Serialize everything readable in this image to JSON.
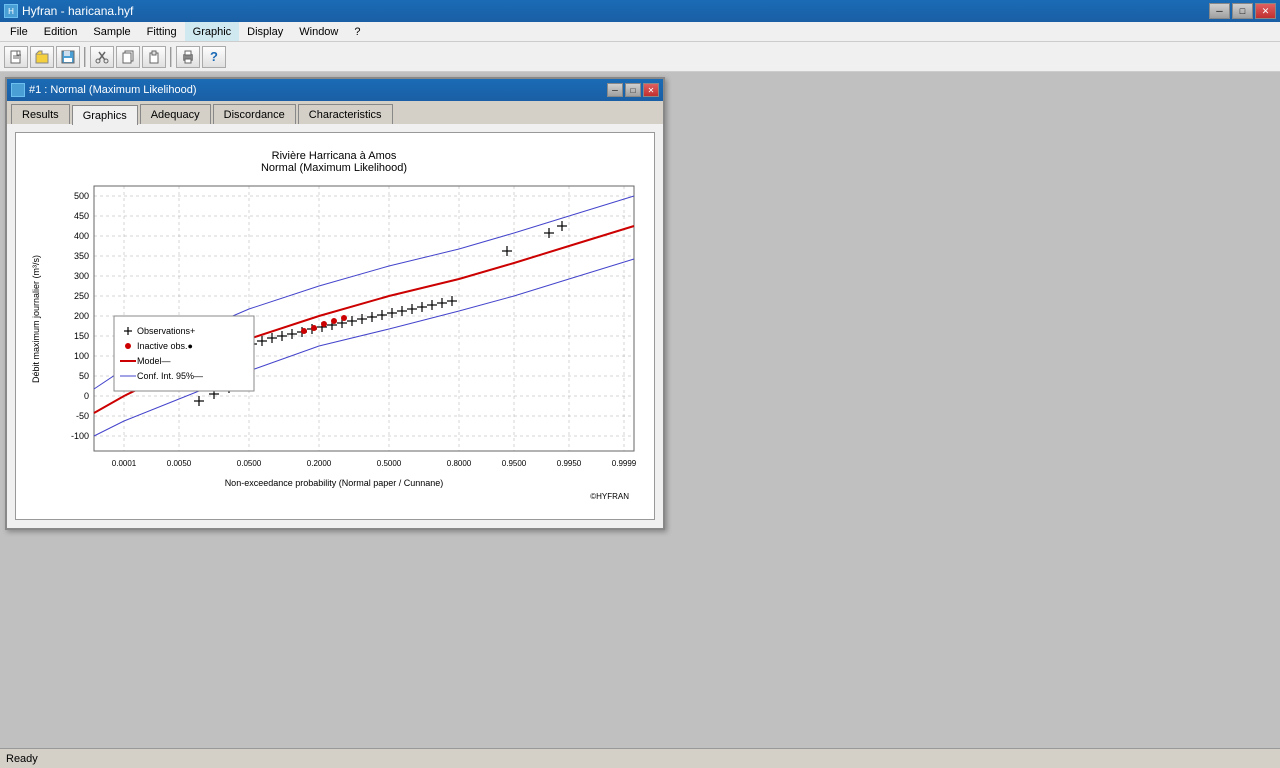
{
  "app": {
    "title": "Hyfran - haricana.hyf",
    "icon": "📊"
  },
  "menu": {
    "items": [
      "File",
      "Edition",
      "Sample",
      "Fitting",
      "Graphic",
      "Display",
      "Window",
      "?"
    ]
  },
  "toolbar": {
    "buttons": [
      {
        "name": "new",
        "icon": "🗋"
      },
      {
        "name": "open",
        "icon": "📂"
      },
      {
        "name": "save",
        "icon": "💾"
      },
      {
        "name": "cut",
        "icon": "✂"
      },
      {
        "name": "copy",
        "icon": "📋"
      },
      {
        "name": "paste",
        "icon": "📌"
      },
      {
        "name": "print",
        "icon": "🖨"
      },
      {
        "name": "help",
        "icon": "?"
      }
    ]
  },
  "panel": {
    "title": "#1 : Normal (Maximum Likelihood)",
    "tabs": [
      "Results",
      "Graphics",
      "Adequacy",
      "Discordance",
      "Characteristics"
    ],
    "active_tab": "Graphics"
  },
  "chart": {
    "title_line1": "Rivière Harricana à Amos",
    "title_line2": "Normal (Maximum Likelihood)",
    "x_label": "Non-exceedance probability (Normal paper / Cunnane)",
    "y_label": "Débit maximum journalier (m³/s)",
    "copyright": "©HYFRAN",
    "legend": {
      "observations": "Observations+",
      "inactive": "Inactive obs.●",
      "model": "Model—",
      "conf_int": "Conf. Int. 95%—"
    },
    "y_axis": [
      "-100",
      "-50",
      "0",
      "50",
      "100",
      "150",
      "200",
      "250",
      "300",
      "350",
      "400",
      "450",
      "500"
    ],
    "x_axis": [
      "0.0001",
      "0.0050",
      "0.0500",
      "0.2000",
      "0.5000",
      "0.8000",
      "0.9500",
      "0.9950",
      "0.9999"
    ]
  },
  "status": {
    "text": "Ready"
  }
}
